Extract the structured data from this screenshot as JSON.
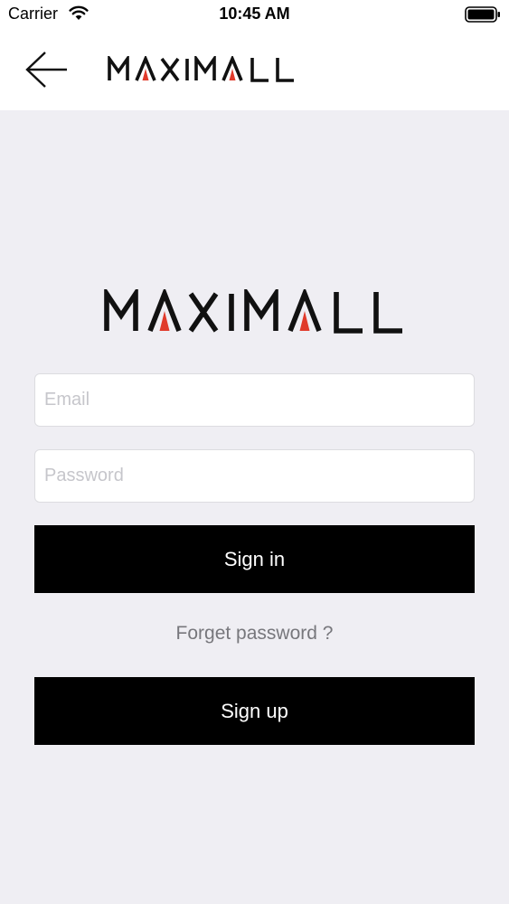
{
  "status_bar": {
    "carrier": "Carrier",
    "time": "10:45 AM",
    "wifi_icon": "wifi-icon",
    "battery_icon": "battery-full-icon"
  },
  "nav": {
    "back_icon": "arrow-left-icon",
    "logo_text": "MAXIMALL"
  },
  "login": {
    "logo_text": "MAXIMALL",
    "email_placeholder": "Email",
    "email_value": "",
    "password_placeholder": "Password",
    "password_value": "",
    "signin_label": "Sign in",
    "forget_label": "Forget password ?",
    "signup_label": "Sign up"
  },
  "colors": {
    "background": "#efeef3",
    "button": "#000000",
    "button_text": "#ffffff",
    "logo_accent": "#e03a2b",
    "link": "#77777c"
  }
}
